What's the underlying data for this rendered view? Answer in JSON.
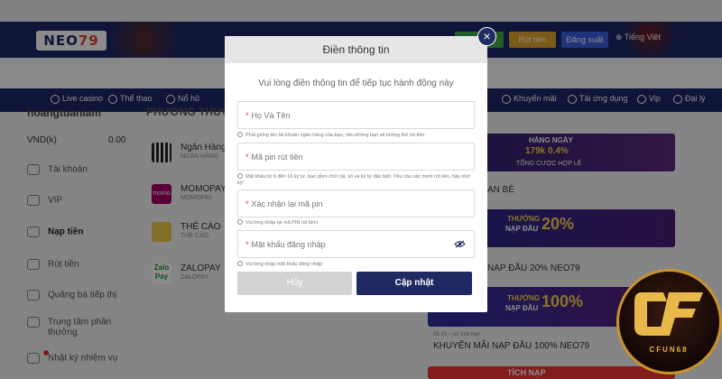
{
  "header": {
    "logo": [
      "NEO",
      "79"
    ],
    "btn_green": "",
    "btn_withdraw": "Rút tiền",
    "btn_logout": "Đăng xuất",
    "language": "Tiếng Việt"
  },
  "nav": {
    "items": [
      "Live casino",
      "Thể thao",
      "Nổ hũ",
      "Khuyến mãi",
      "Tải ứng dụng",
      "Vip",
      "Đại lý"
    ]
  },
  "sidebar": {
    "username": "hoangtuanlam",
    "balance_label": "VND(k)",
    "balance_value": "0.00",
    "items": [
      "Tài khoản",
      "VIP",
      "Nạp tiền",
      "Rút tiền",
      "Quảng bá tiếp thị",
      "Trung tâm phần",
      "thưởng",
      "Nhật ký nhiệm vụ"
    ]
  },
  "payments": {
    "title": "PHƯƠNG THỨC",
    "items": [
      {
        "name": "Ngân Hàng N",
        "sub": "NGÂN HÀNG"
      },
      {
        "name": "MOMOPAY",
        "sub": "MOMOPAY"
      },
      {
        "name": "THẺ CÀO",
        "sub": "THẺ CÀO"
      },
      {
        "name": "ZALOPAY",
        "sub": "ZALOPAY"
      }
    ],
    "momo_logo": "momo",
    "zalo_logo": [
      "Zalo",
      "Pay"
    ]
  },
  "promos": {
    "p1_top": "HÀNG NGÀY",
    "p1_rates": "179k  0.4%",
    "p1_sub": "TỔNG CƯỢC HỢP LỆ",
    "p1_text": "ẠN BÈ",
    "p2_text": "NẠP ĐẦU 20% NEO79",
    "p2_badge": "THƯỞNG",
    "p2_badge_sub": "NẠP ĐẦU",
    "p2_pct": "20%",
    "p3_badge": "THƯỞNG",
    "p3_badge_sub": "NẠP ĐẦU",
    "p3_pct": "100%",
    "p3_date": "06-25 ~ vô thời hạn",
    "p3_text": "KHUYẾN MÃI NẠP ĐẦU 100% NEO79",
    "p4_text": "TÍCH NẠP"
  },
  "modal": {
    "title": "Điền thông tin",
    "close": "×",
    "subtitle": "Vui lòng điền thông tin để tiếp tục hành động này",
    "fields": [
      {
        "placeholder": "Họ Và Tên",
        "required": true,
        "hint": "Phải giống tên tài khoản ngân hàng của bạn, nếu không bạn sẽ không thể rút tiền"
      },
      {
        "placeholder": "Mã pin rút tiền",
        "required": true,
        "hint": "Mật khẩu từ 6 đến 16 ký tự, bao gồm chữ cái, số và ký tự đặc biệt. Yêu cầu xác minh rút tiền, hãy nhớ kỹ!"
      },
      {
        "placeholder": "Xác nhận lại mã pin",
        "required": true,
        "hint": "Vui lòng nhập lại mã PIN rút tiền!"
      },
      {
        "placeholder": "Mật khẩu đăng nhập",
        "required": true,
        "hint": "Vui lòng nhập mật khẩu đăng nhập"
      }
    ],
    "cancel": "Hủy",
    "submit": "Cập nhật"
  },
  "watermark": {
    "text": "CFUN68"
  },
  "colors": {
    "navy": "#1f2a63",
    "cancel_gray": "#d3d3d3",
    "required_red": "#e33333",
    "gold": "#c9932b"
  }
}
